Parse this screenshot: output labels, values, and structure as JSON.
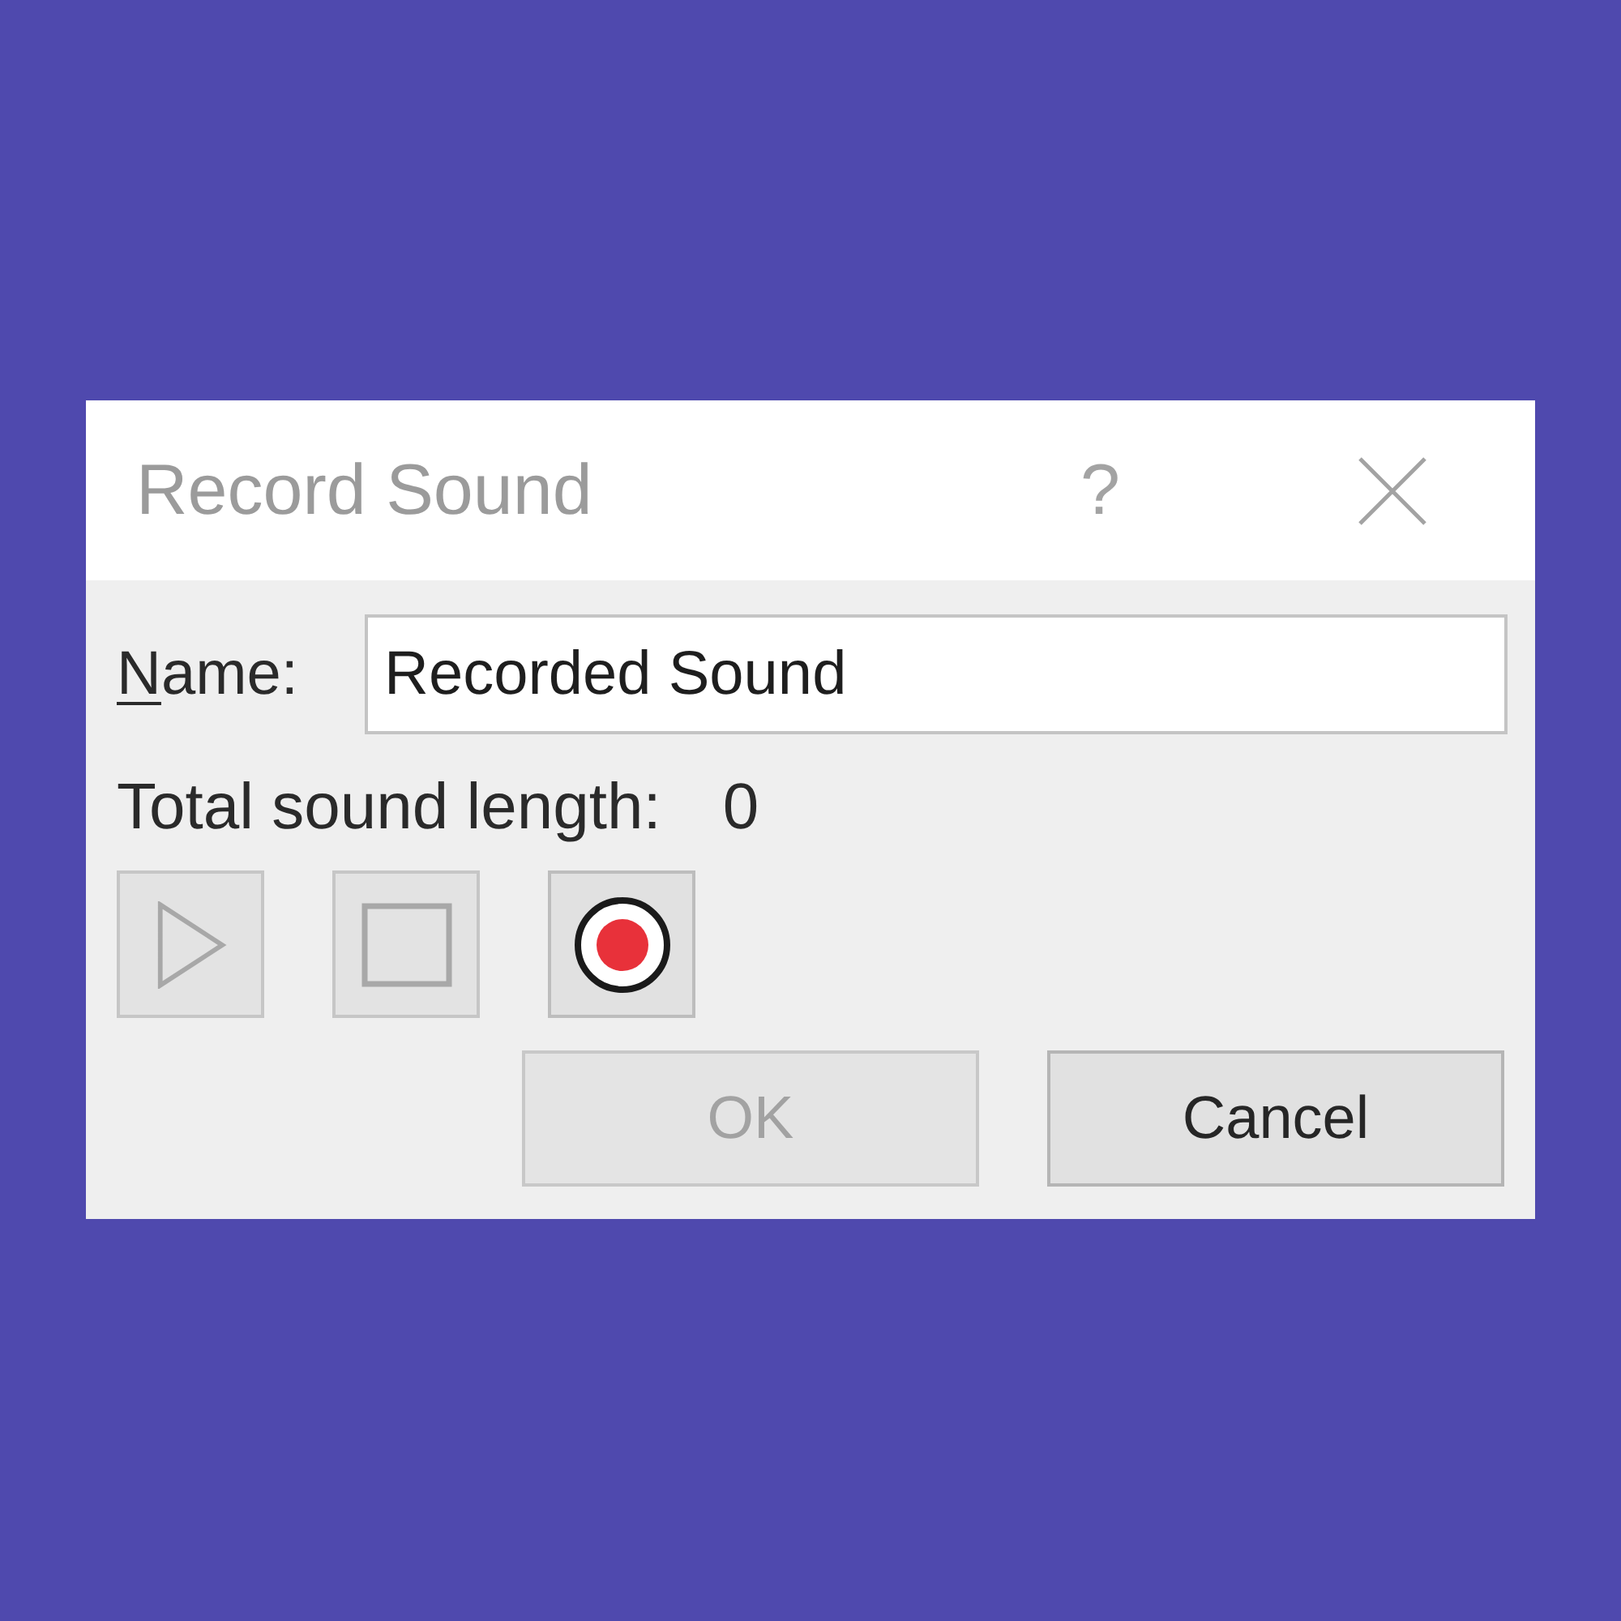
{
  "window": {
    "title": "Record Sound",
    "help": "?"
  },
  "name_field": {
    "label": "Name:",
    "access_key_underlined": true,
    "value": "Recorded Sound"
  },
  "total_length": {
    "label": "Total sound length:",
    "value": "0"
  },
  "transport": [
    {
      "kind": "play",
      "disabled": true
    },
    {
      "kind": "stop",
      "disabled": true
    },
    {
      "kind": "record",
      "disabled": false
    }
  ],
  "buttons": [
    {
      "label": "OK",
      "disabled": true
    },
    {
      "label": "Cancel",
      "disabled": false
    }
  ]
}
